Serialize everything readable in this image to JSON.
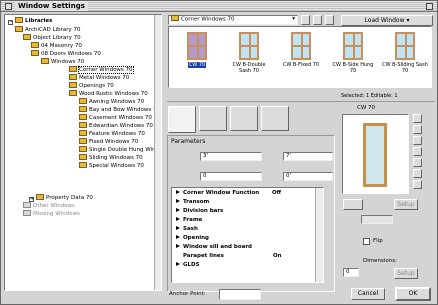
{
  "window": {
    "title": "Window Settings"
  },
  "tree": {
    "header": "Libraries",
    "items": [
      {
        "label": "ArchiCAD Library 70"
      },
      {
        "label": "Object Library 70"
      },
      {
        "label": "04 Masonry 70"
      },
      {
        "label": "08 Doors Windows 70"
      },
      {
        "label": "Windows 70"
      },
      {
        "label": "Corner Windows 70"
      },
      {
        "label": "Metal Windows 70"
      },
      {
        "label": "Openings 70"
      },
      {
        "label": "Wood Rustic Windows 70"
      },
      {
        "label": "Awning Windows 70"
      },
      {
        "label": "Bay and Bow Windows 70"
      },
      {
        "label": "Casement Windows 70"
      },
      {
        "label": "Edwardian Windows 70"
      },
      {
        "label": "Feature Windows 70"
      },
      {
        "label": "Fixed Windows 70"
      },
      {
        "label": "Single Double Hung Wind"
      },
      {
        "label": "Sliding Windows 70"
      },
      {
        "label": "Special Windows 70"
      },
      {
        "label": "Property Data 70"
      },
      {
        "label": "Other Windows"
      },
      {
        "label": "Missing Windows"
      }
    ]
  },
  "library_select": {
    "value": "Corner Windows 70"
  },
  "load_button": "Load Window",
  "thumbnails": [
    {
      "label": "CW 70",
      "selected": true
    },
    {
      "label": "CW B-Double Sash 70"
    },
    {
      "label": "CW B-Fixed 70"
    },
    {
      "label": "CW B-Side Hung 70"
    },
    {
      "label": "CW B-Sliding Sash 70"
    }
  ],
  "selection_status": "Selected: 1 Editable: 1",
  "preview_title": "CW 70",
  "parameters": {
    "header": "Parameters",
    "width": "3'",
    "height": "7'",
    "elev1": "0",
    "elev2": "0'",
    "rows": [
      {
        "name": "Corner Window Function",
        "value": "Off"
      },
      {
        "name": "Transom",
        "value": ""
      },
      {
        "name": "Division bars",
        "value": ""
      },
      {
        "name": "Frame",
        "value": ""
      },
      {
        "name": "Sash",
        "value": ""
      },
      {
        "name": "Opening",
        "value": ""
      },
      {
        "name": "Window sill and board",
        "value": ""
      },
      {
        "name": "Parapet lines",
        "value": "On"
      },
      {
        "name": "GLDS",
        "value": ""
      }
    ]
  },
  "right_panel": {
    "setup_label": "Setup",
    "flip_label": "Flip",
    "dimensions_label": "Dimensions:",
    "dim_value": "0",
    "setup2_label": "Setup"
  },
  "anchor_point_label": "Anchor Point:",
  "cancel_label": "Cancel",
  "ok_label": "OK"
}
